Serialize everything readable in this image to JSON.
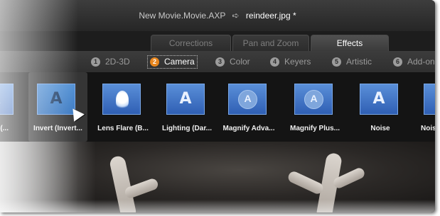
{
  "titlebar": {
    "project": "New Movie.Movie.AXP",
    "arrow": "➪",
    "file": "reindeer.jpg",
    "marker": "*"
  },
  "tabs": [
    {
      "label": "Corrections",
      "active": false
    },
    {
      "label": "Pan and Zoom",
      "active": false
    },
    {
      "label": "Effects",
      "active": true
    }
  ],
  "categories": [
    {
      "num": "1",
      "label": "2D-3D",
      "active": false
    },
    {
      "num": "2",
      "label": "Camera",
      "active": true
    },
    {
      "num": "3",
      "label": "Color",
      "active": false
    },
    {
      "num": "4",
      "label": "Keyers",
      "active": false
    },
    {
      "num": "5",
      "label": "Artistic",
      "active": false
    },
    {
      "num": "6",
      "label": "Add-ons",
      "active": false
    }
  ],
  "effects": [
    {
      "label": "e (...",
      "icon": "letter-a"
    },
    {
      "label": "Invert (Invert...",
      "icon": "letter-a",
      "selected": true
    },
    {
      "label": "Lens Flare (B...",
      "icon": "lens-flare"
    },
    {
      "label": "Lighting (Dar...",
      "icon": "letter-a"
    },
    {
      "label": "Magnify Adva...",
      "icon": "magnify-circle"
    },
    {
      "label": "Magnify Plus...",
      "icon": "magnify-circle"
    },
    {
      "label": "Noise",
      "icon": "letter-a"
    },
    {
      "label": "Noise I",
      "icon": "letter-a"
    }
  ],
  "icon_glyph": "A",
  "colors": {
    "accent": "#e8861e",
    "thumb_blue": "#3f74c4",
    "panel": "#141414"
  }
}
